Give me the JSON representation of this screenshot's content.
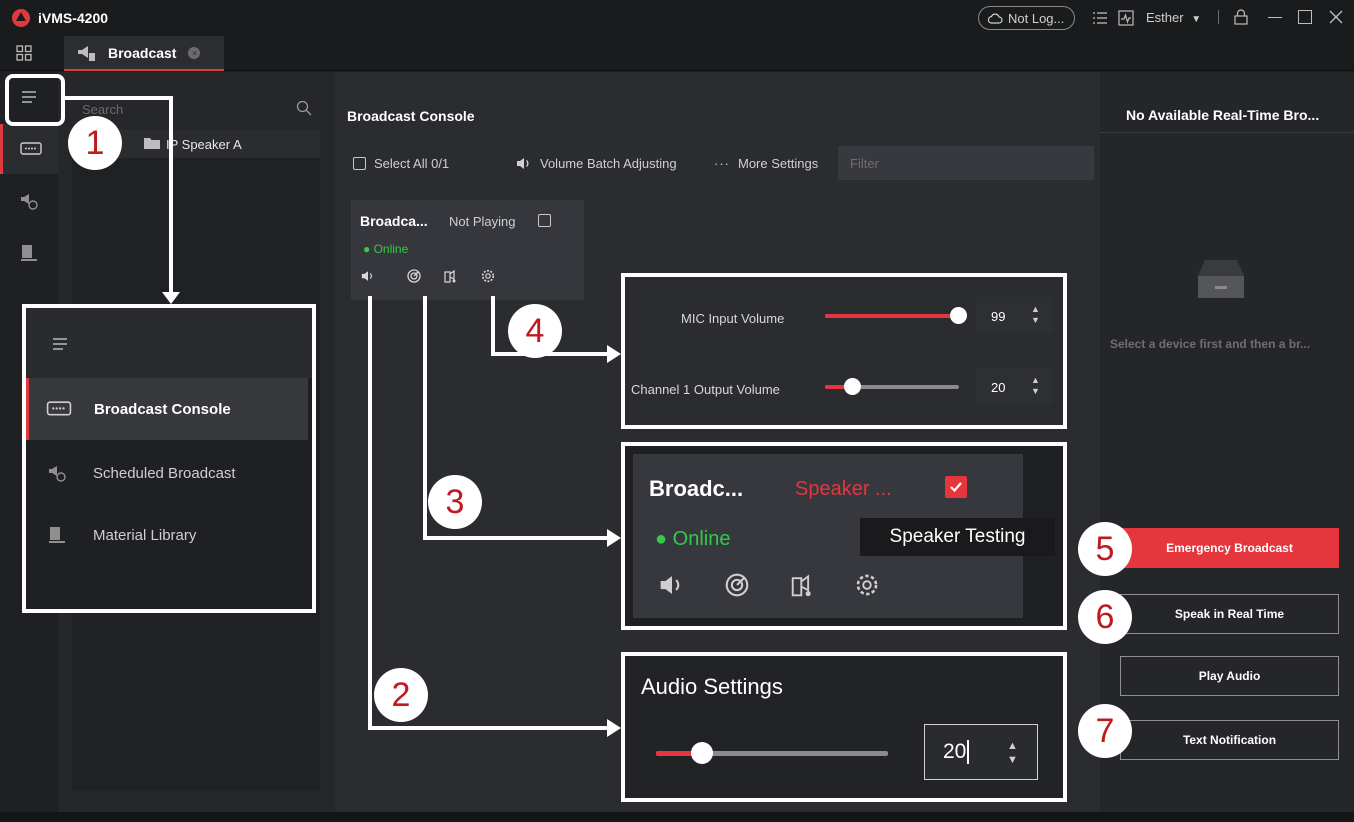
{
  "app": {
    "title": "iVMS-4200"
  },
  "titlebar": {
    "login_status": "Not Log...",
    "user": "Esther"
  },
  "tabs": [
    {
      "label": "Broadcast"
    }
  ],
  "device_panel": {
    "search_placeholder": "Search",
    "device_name": "IP Speaker A"
  },
  "console": {
    "title": "Broadcast Console",
    "select_all": "Select All 0/1",
    "volume_batch": "Volume Batch Adjusting",
    "more_settings": "More Settings",
    "filter_placeholder": "Filter",
    "card": {
      "name": "Broadca...",
      "status": "Not Playing",
      "online": "Online"
    }
  },
  "right_panel": {
    "title": "No Available Real-Time Bro...",
    "tip": "Select a device first and then a br...",
    "buttons": [
      "Emergency Broadcast",
      "Speak in Real Time",
      "Play Audio",
      "Text Notification"
    ]
  },
  "annotations": {
    "numbers": [
      "1",
      "2",
      "3",
      "4",
      "5",
      "6",
      "7"
    ],
    "menu": {
      "items": [
        "Broadcast Console",
        "Scheduled Broadcast",
        "Material Library"
      ]
    },
    "volume_box": {
      "mic_label": "MIC Input Volume",
      "mic_value": "99",
      "mic_level": 0.99,
      "channel_label": "Channel 1 Output Volume",
      "channel_value": "20",
      "channel_level": 0.2
    },
    "zoom_card": {
      "name": "Broadc...",
      "status": "Speaker ...",
      "online": "Online",
      "tooltip": "Speaker Testing"
    },
    "audio_settings": {
      "title": "Audio Settings",
      "value": "20",
      "level": 0.2
    }
  },
  "colors": {
    "accent_red": "#e5353d",
    "online_green": "#34c94a",
    "background": "#2b2c30"
  }
}
